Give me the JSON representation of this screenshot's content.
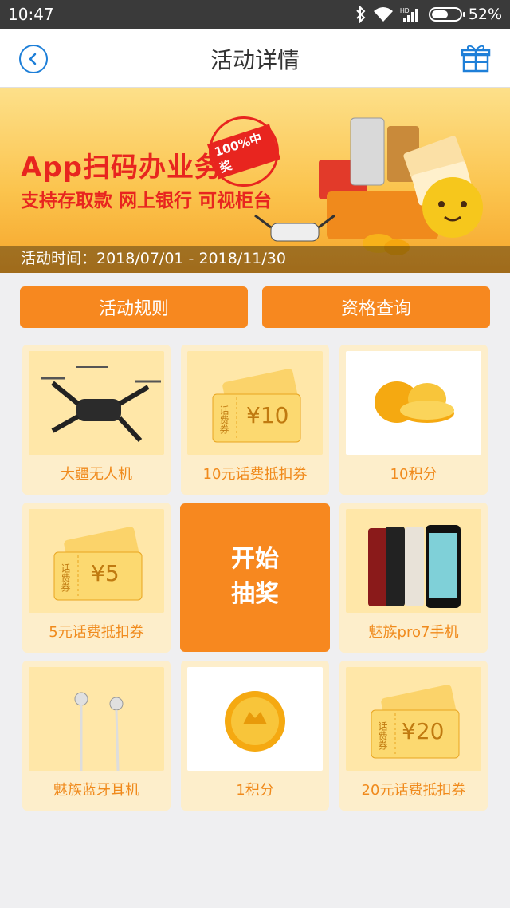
{
  "status_bar": {
    "time": "10:47",
    "battery": "52%",
    "icons": [
      "bluetooth-icon",
      "wifi-icon",
      "signal-icon",
      "battery-icon"
    ]
  },
  "nav": {
    "title": "活动详情",
    "left_icon": "back-icon",
    "right_icon": "gift-icon"
  },
  "banner": {
    "headline": "App扫码办业务",
    "subline": "支持存取款 网上银行 可视柜台",
    "stamp": "100%中奖",
    "period": "活动时间：2018/07/01 - 2018/11/30"
  },
  "buttons": {
    "rules": "活动规则",
    "qualification": "资格查询"
  },
  "prizes": [
    {
      "label": "大疆无人机",
      "icon": "drone-icon"
    },
    {
      "label": "10元话费抵扣券",
      "icon": "coupon-icon",
      "value": "¥10",
      "ticket": "话费券"
    },
    {
      "label": "10积分",
      "icon": "coins-icon"
    },
    {
      "label": "5元话费抵扣券",
      "icon": "coupon-icon",
      "value": "¥5",
      "ticket": "话费券"
    },
    {
      "label": "魅族pro7手机",
      "icon": "phone-icon"
    },
    {
      "label": "魅族蓝牙耳机",
      "icon": "earphones-icon"
    },
    {
      "label": "1积分",
      "icon": "coin-icon"
    },
    {
      "label": "20元话费抵扣券",
      "icon": "coupon-icon",
      "value": "¥20",
      "ticket": "话费券"
    }
  ],
  "start_button": {
    "line1": "开始",
    "line2": "抽奖"
  },
  "colors": {
    "accent": "#f7881f",
    "banner_text": "#e8251f",
    "cell_bg": "#fdeecb",
    "link_blue": "#1e7fd8"
  }
}
